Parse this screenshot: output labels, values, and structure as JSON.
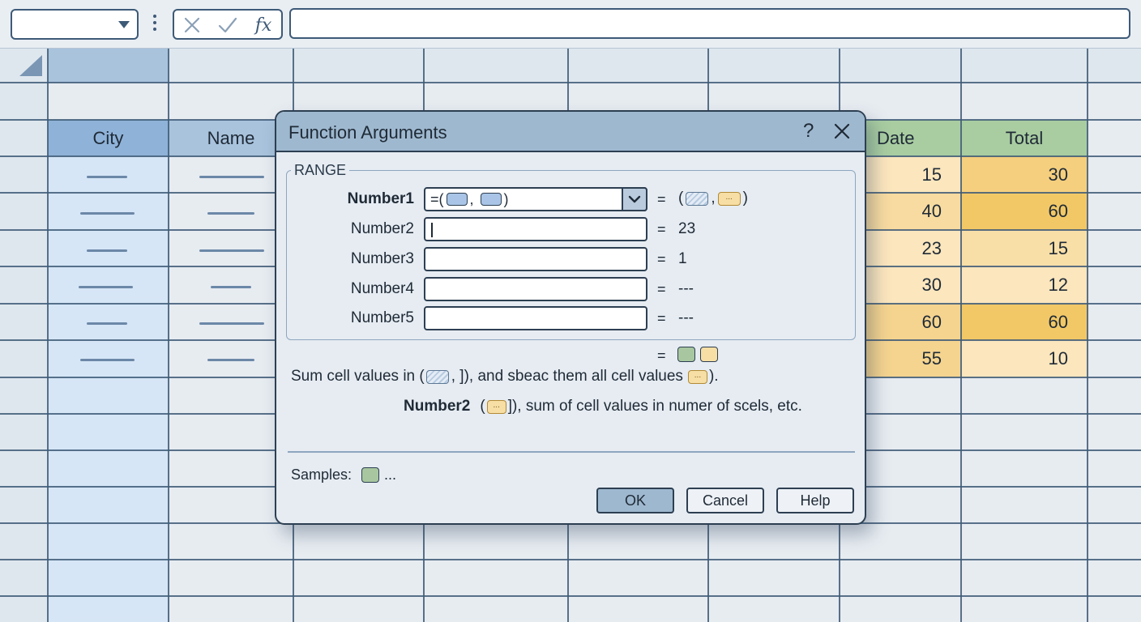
{
  "formula_bar": {
    "name_box_value": "",
    "cancel_icon": "x-icon",
    "enter_icon": "check-icon",
    "function_label": "fx",
    "formula_value": ""
  },
  "sheet": {
    "headers": {
      "city": "City",
      "name": "Name",
      "date": "Date",
      "total": "Total"
    },
    "date_values": [
      "15",
      "40",
      "23",
      "30",
      "60",
      "55"
    ],
    "total_values": [
      "30",
      "60",
      "15",
      "12",
      "60",
      "10"
    ],
    "colors": {
      "header_blue": "#8fb2d8",
      "city_column": "#d6e6f7",
      "header_green": "#a9cda1",
      "date_light": "#fbe6bd",
      "date_dark": "#f5d48f",
      "total_light": "#f8dfa8",
      "total_dark": "#f2c867"
    }
  },
  "dialog": {
    "title": "Function Arguments",
    "help_glyph": "?",
    "group_label": "RANGE",
    "args": [
      {
        "label": "Number1",
        "value": "=(",
        "sep": ",",
        "close": ")",
        "eq": "=",
        "result": "(",
        "result_sep": ",",
        "result_close": ")"
      },
      {
        "label": "Number2",
        "value": "",
        "eq": "=",
        "result": "23"
      },
      {
        "label": "Number3",
        "value": "",
        "eq": "=",
        "result": "1"
      },
      {
        "label": "Number4",
        "value": "",
        "eq": "=",
        "result": "---"
      },
      {
        "label": "Number5",
        "value": "",
        "eq": "=",
        "result": "---"
      }
    ],
    "formula_result_eq": "=",
    "description": {
      "part1": "Sum cell values in (",
      "part2": ", ]), and sbeac them all cell values",
      "part3": ")."
    },
    "arg_help": {
      "name": "Number2",
      "open": "(",
      "text": "]), sum of cell values in numer of scels, etc."
    },
    "samples_label": "Samples:",
    "samples_suffix": "...",
    "chip_mark": "...",
    "buttons": {
      "ok": "OK",
      "cancel": "Cancel",
      "help": "Help"
    }
  }
}
